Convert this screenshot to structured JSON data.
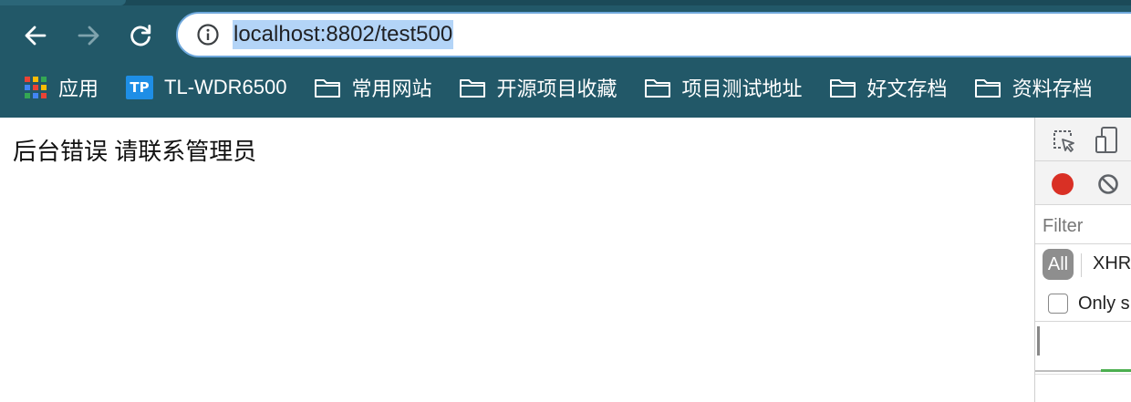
{
  "browser": {
    "address_bar": {
      "url": "localhost:8802/test500"
    },
    "bookmarks": [
      {
        "label": "应用",
        "icon": "apps-grid-icon"
      },
      {
        "label": "TL-WDR6500",
        "icon": "tp-link-logo",
        "logo_text": "TP"
      },
      {
        "label": "常用网站",
        "icon": "folder-icon"
      },
      {
        "label": "开源项目收藏",
        "icon": "folder-icon"
      },
      {
        "label": "项目测试地址",
        "icon": "folder-icon"
      },
      {
        "label": "好文存档",
        "icon": "folder-icon"
      },
      {
        "label": "资料存档",
        "icon": "folder-icon"
      }
    ],
    "colors": {
      "chrome": "#225868",
      "selection": "#b3d4f7"
    }
  },
  "page": {
    "message": "后台错误 请联系管理员"
  },
  "devtools": {
    "filter_placeholder": "Filter",
    "type_all": "All",
    "type_xhr": "XHR",
    "only_label": "Only s"
  }
}
